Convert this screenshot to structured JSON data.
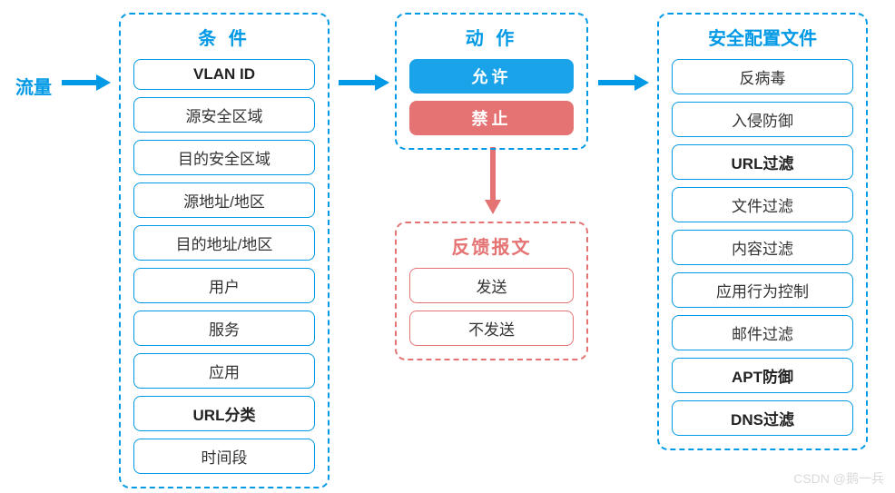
{
  "traffic_label": "流量",
  "conditions": {
    "title": "条 件",
    "items": [
      {
        "label": "VLAN ID",
        "bold": true
      },
      {
        "label": "源安全区域",
        "bold": false
      },
      {
        "label": "目的安全区域",
        "bold": false
      },
      {
        "label": "源地址/地区",
        "bold": false
      },
      {
        "label": "目的地址/地区",
        "bold": false
      },
      {
        "label": "用户",
        "bold": false
      },
      {
        "label": "服务",
        "bold": false
      },
      {
        "label": "应用",
        "bold": false
      },
      {
        "label": "URL分类",
        "bold": true
      },
      {
        "label": "时间段",
        "bold": false
      }
    ]
  },
  "actions": {
    "title": "动 作",
    "allow": "允许",
    "deny": "禁止"
  },
  "feedback": {
    "title": "反馈报文",
    "items": [
      {
        "label": "发送"
      },
      {
        "label": "不发送"
      }
    ]
  },
  "profiles": {
    "title": "安全配置文件",
    "items": [
      {
        "label": "反病毒",
        "bold": false
      },
      {
        "label": "入侵防御",
        "bold": false
      },
      {
        "label": "URL过滤",
        "bold": true
      },
      {
        "label": "文件过滤",
        "bold": false
      },
      {
        "label": "内容过滤",
        "bold": false
      },
      {
        "label": "应用行为控制",
        "bold": false
      },
      {
        "label": "邮件过滤",
        "bold": false
      },
      {
        "label": "APT防御",
        "bold": true
      },
      {
        "label": "DNS过滤",
        "bold": true
      }
    ]
  },
  "watermark": "CSDN @鹅一兵"
}
